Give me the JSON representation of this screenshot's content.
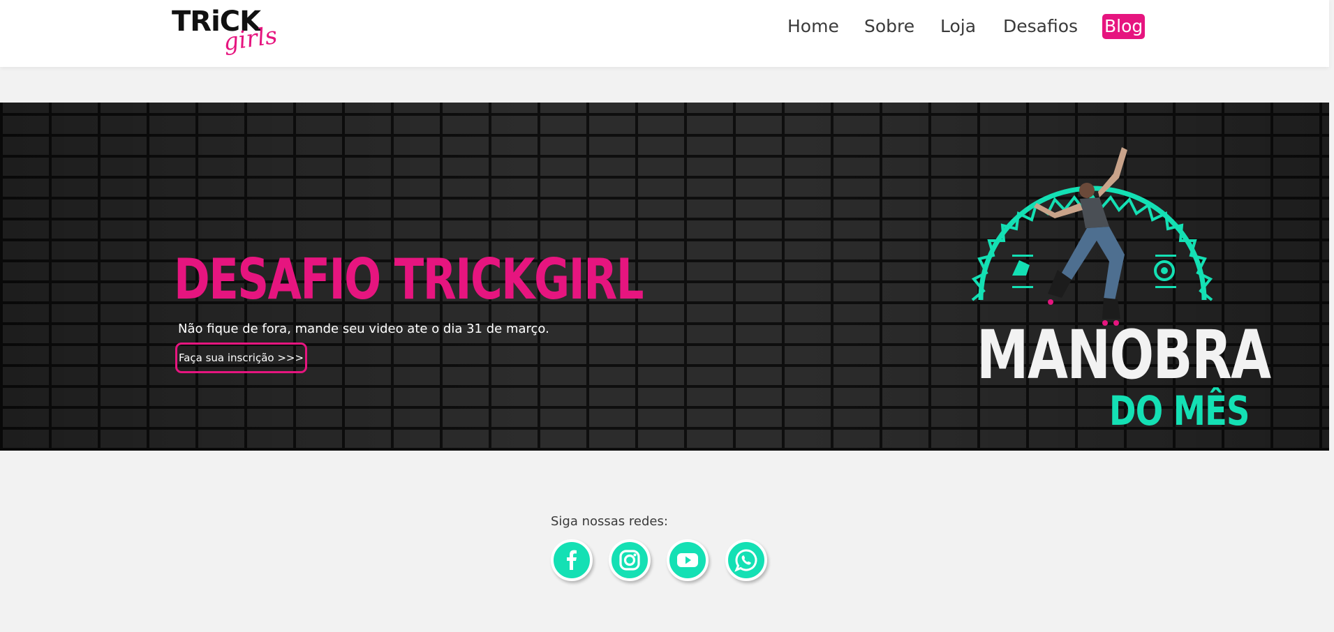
{
  "header": {
    "logo": {
      "word1": "TRiCK",
      "word2": "girls"
    },
    "nav": [
      {
        "label": "Home"
      },
      {
        "label": "Sobre"
      },
      {
        "label": "Loja"
      },
      {
        "label": "Desafios"
      },
      {
        "label": "Blog",
        "active": true
      }
    ]
  },
  "banner": {
    "title": "DESAFIO TRICKGIRL",
    "subtitle": "Não fique de fora, mande seu video ate o dia 31 de março.",
    "cta_label": "Faça sua inscrição >>>",
    "badge": {
      "line1": "MANOBRA",
      "line2": "DO MÊS"
    }
  },
  "social": {
    "label": "Siga nossas redes:",
    "icons": [
      "facebook-icon",
      "instagram-icon",
      "youtube-icon",
      "whatsapp-icon"
    ]
  },
  "colors": {
    "brand_pink": "#e6157f",
    "accent_teal": "#14e0b4",
    "page_bg": "#f2f2f2",
    "header_bg": "#ffffff"
  }
}
